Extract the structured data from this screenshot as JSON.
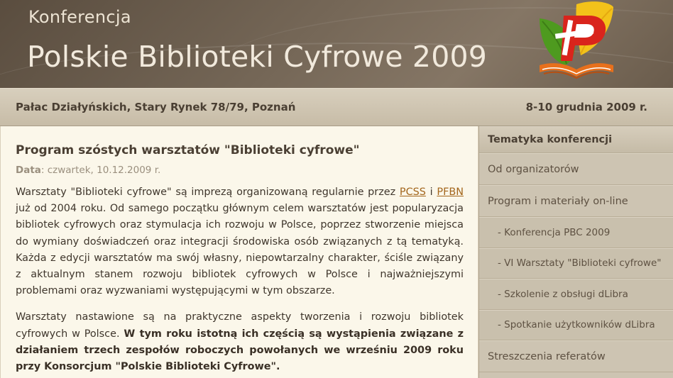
{
  "header": {
    "label": "Konferencja",
    "title": "Polskie Biblioteki Cyfrowe 2009",
    "logo_icon": "pbc-logo-icon"
  },
  "infobar": {
    "venue": "Pałac Działyńskich, Stary Rynek 78/79, Poznań",
    "dates": "8-10 grudnia 2009 r."
  },
  "article": {
    "title": "Program szóstych warsztatów \"Biblioteki cyfrowe\"",
    "date_label": "Data",
    "date_value": ": czwartek, 10.12.2009 r.",
    "p1_a": "Warsztaty \"Biblioteki cyfrowe\" są imprezą organizowaną regularnie przez ",
    "link_pcss": "PCSS",
    "p1_b": " i ",
    "link_pfbn": "PFBN",
    "p1_c": " już od 2004 roku. Od samego początku głównym celem warsztatów jest popularyzacja bibliotek cyfrowych oraz stymulacja ich rozwoju w Polsce, poprzez stworzenie miejsca do wymiany doświadczeń oraz integracji środowiska osób związanych z tą tematyką. Każda z edycji warsztatów ma swój własny, niepowtarzalny charakter, ściśle związany z aktualnym stanem rozwoju bibliotek cyfrowych w Polsce i najważniejszymi problemami oraz wyzwaniami występującymi w tym obszarze.",
    "p2_a": "Warsztaty nastawione są na praktyczne aspekty tworzenia i rozwoju bibliotek cyfrowych w Polsce. ",
    "p2_bold": "W tym roku istotną ich częścią są wystąpienia związane z działaniem trzech zespołów roboczych powołanych we wrześniu 2009 roku przy Konsorcjum \"Polskie Biblioteki Cyfrowe\"."
  },
  "sidebar": {
    "heading": "Tematyka konferencji",
    "items": [
      {
        "label": "Od organizatorów"
      },
      {
        "label": "Program i materiały on-line"
      },
      {
        "label": "- Konferencja PBC 2009"
      },
      {
        "label": "- VI Warsztaty \"Biblioteki cyfrowe\""
      },
      {
        "label": "- Szkolenie z obsługi dLibra"
      },
      {
        "label": "- Spotkanie użytkowników dLibra"
      },
      {
        "label": "Streszczenia referatów"
      }
    ]
  },
  "colors": {
    "header_bg": "#756757",
    "content_bg": "#fbf7ea",
    "sidebar_bg": "#cdc4b2",
    "link": "#a3661c",
    "logo_red": "#d9241c",
    "logo_green": "#4e9a1f",
    "logo_yellow": "#f3c21a",
    "logo_orange": "#e8701c"
  }
}
